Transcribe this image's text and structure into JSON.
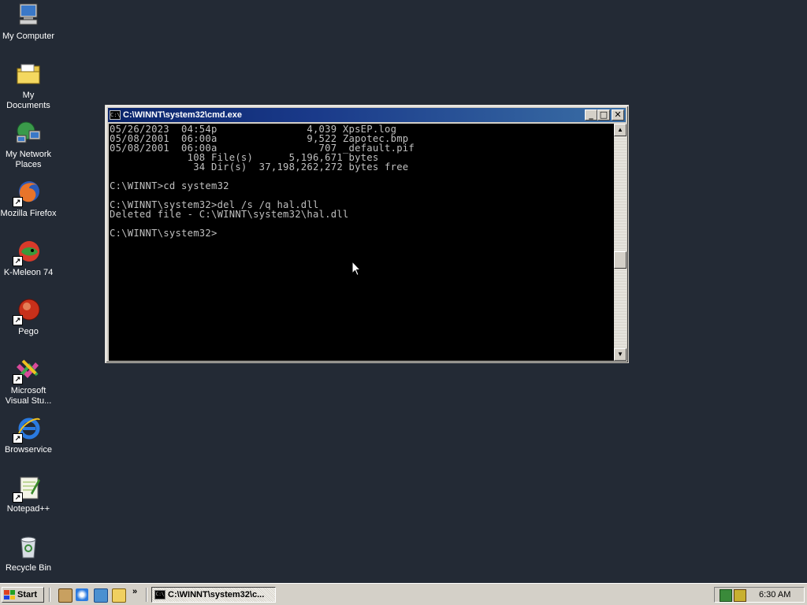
{
  "desktop": {
    "icons": [
      {
        "label": "My Computer",
        "icon": "computer-icon"
      },
      {
        "label": "My Documents",
        "icon": "folder-icon"
      },
      {
        "label": "My Network\nPlaces",
        "icon": "network-icon"
      },
      {
        "label": "Mozilla Firefox",
        "icon": "firefox-icon"
      },
      {
        "label": "K-Meleon 74",
        "icon": "kmeleon-icon"
      },
      {
        "label": "Pego",
        "icon": "pego-icon"
      },
      {
        "label": "Microsoft\nVisual Stu...",
        "icon": "visual-studio-icon"
      },
      {
        "label": "Browservice",
        "icon": "ie-icon"
      },
      {
        "label": "Notepad++",
        "icon": "notepadpp-icon"
      },
      {
        "label": "Recycle Bin",
        "icon": "recycle-bin-icon"
      }
    ]
  },
  "window": {
    "title": "C:\\WINNT\\system32\\cmd.exe",
    "icon_text": "C:\\",
    "minimize": "_",
    "maximize": "□",
    "close": "✕",
    "console_lines": [
      "05/26/2023  04:54p               4,039 XpsEP.log",
      "05/08/2001  06:00a               9,522 Zapotec.bmp",
      "05/08/2001  06:00a                 707 _default.pif",
      "             108 File(s)      5,196,671 bytes",
      "              34 Dir(s)  37,198,262,272 bytes free",
      "",
      "C:\\WINNT>cd system32",
      "",
      "C:\\WINNT\\system32>del /s /q hal.dll",
      "Deleted file - C:\\WINNT\\system32\\hal.dll",
      "",
      "C:\\WINNT\\system32>"
    ],
    "scroll_up": "▲",
    "scroll_down": "▼"
  },
  "taskbar": {
    "start_label": "Start",
    "quick_launch_more": "»",
    "task_label": "C:\\WINNT\\system32\\c...",
    "clock": "6:30 AM"
  },
  "colors": {
    "desktop_bg": "#232a35",
    "title_active": "#0a246a",
    "console_bg": "#000000",
    "console_text": "#c0c0c0"
  }
}
